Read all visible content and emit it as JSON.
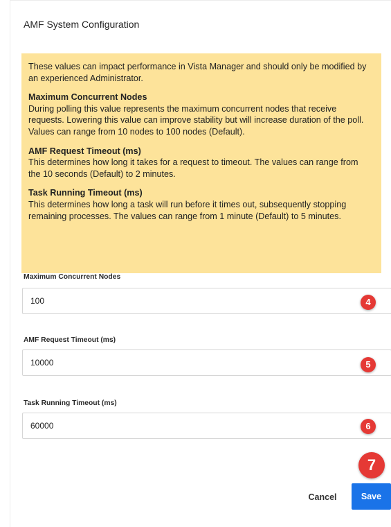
{
  "dialog": {
    "title": "AMF System Configuration"
  },
  "info": {
    "intro": "These values can impact performance in Vista Manager and should only be modified by an experienced Administrator.",
    "sections": [
      {
        "heading": "Maximum Concurrent Nodes",
        "body": "During polling this value represents the maximum concurrent nodes that receive requests. Lowering this value can improve stability but will increase duration of the poll. Values can range from 10 nodes to 100 nodes (Default)."
      },
      {
        "heading": "AMF Request Timeout (ms)",
        "body": "This determines how long it takes for a request to timeout. The values can range from the 10 seconds (Default) to 2 minutes."
      },
      {
        "heading": "Task Running Timeout (ms)",
        "body": "This determines how long a task will run before it times out, subsequently stopping remaining processes. The values can range from 1 minute (Default) to 5 minutes."
      }
    ]
  },
  "fields": [
    {
      "label": "Maximum Concurrent Nodes",
      "value": "100",
      "badge": "4"
    },
    {
      "label": "AMF Request Timeout (ms)",
      "value": "10000",
      "badge": "5"
    },
    {
      "label": "Task Running Timeout (ms)",
      "value": "60000",
      "badge": "6"
    }
  ],
  "actions": {
    "cancel_label": "Cancel",
    "save_label": "Save",
    "save_badge": "7"
  },
  "colors": {
    "info_background": "#fde39a",
    "primary_button": "#1a73e8",
    "badge": "#e53935"
  }
}
